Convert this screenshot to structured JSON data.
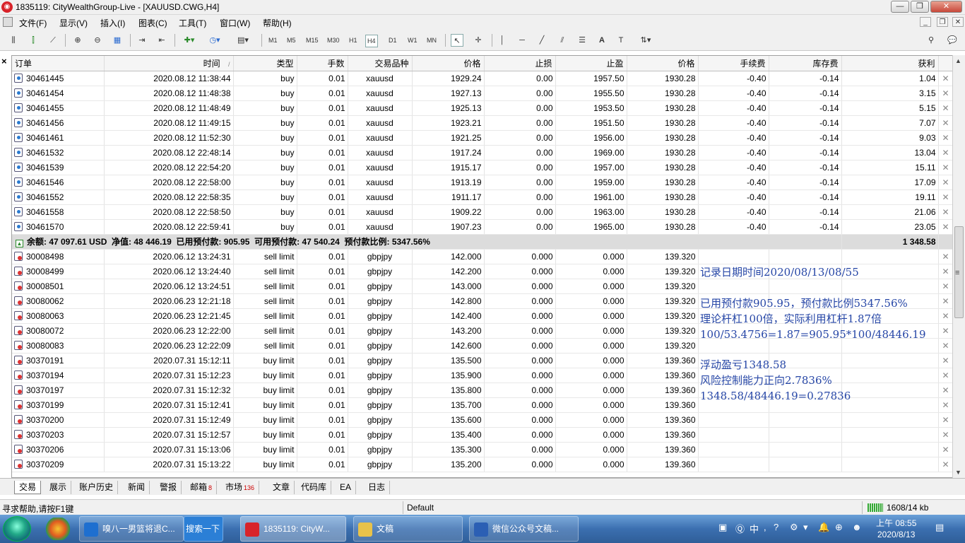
{
  "window": {
    "title": "1835119: CityWealthGroup-Live - [XAUUSD.CWG,H4]",
    "minimize": "—",
    "restore": "❐",
    "close": "✕"
  },
  "menu": {
    "items": [
      "文件(F)",
      "显示(V)",
      "插入(I)",
      "图表(C)",
      "工具(T)",
      "窗口(W)",
      "帮助(H)"
    ]
  },
  "toolbar": {
    "timeframes": [
      "M1",
      "M5",
      "M15",
      "M30",
      "H1",
      "H4",
      "D1",
      "W1",
      "MN"
    ],
    "active_timeframe": "H4"
  },
  "table": {
    "columns": [
      "订单",
      "时间",
      "类型",
      "手数",
      "交易品种",
      "价格",
      "止损",
      "止盈",
      "价格",
      "手续费",
      "库存费",
      "获利"
    ],
    "time_sort_marker": "/",
    "open_positions": [
      {
        "order": "30461445",
        "time": "2020.08.12 11:38:44",
        "type": "buy",
        "lots": "0.01",
        "symbol": "xauusd",
        "price": "1929.24",
        "sl": "0.00",
        "tp": "1957.50",
        "cur": "1930.28",
        "commission": "-0.40",
        "swap": "-0.14",
        "profit": "1.04"
      },
      {
        "order": "30461454",
        "time": "2020.08.12 11:48:38",
        "type": "buy",
        "lots": "0.01",
        "symbol": "xauusd",
        "price": "1927.13",
        "sl": "0.00",
        "tp": "1955.50",
        "cur": "1930.28",
        "commission": "-0.40",
        "swap": "-0.14",
        "profit": "3.15"
      },
      {
        "order": "30461455",
        "time": "2020.08.12 11:48:49",
        "type": "buy",
        "lots": "0.01",
        "symbol": "xauusd",
        "price": "1925.13",
        "sl": "0.00",
        "tp": "1953.50",
        "cur": "1930.28",
        "commission": "-0.40",
        "swap": "-0.14",
        "profit": "5.15"
      },
      {
        "order": "30461456",
        "time": "2020.08.12 11:49:15",
        "type": "buy",
        "lots": "0.01",
        "symbol": "xauusd",
        "price": "1923.21",
        "sl": "0.00",
        "tp": "1951.50",
        "cur": "1930.28",
        "commission": "-0.40",
        "swap": "-0.14",
        "profit": "7.07"
      },
      {
        "order": "30461461",
        "time": "2020.08.12 11:52:30",
        "type": "buy",
        "lots": "0.01",
        "symbol": "xauusd",
        "price": "1921.25",
        "sl": "0.00",
        "tp": "1956.00",
        "cur": "1930.28",
        "commission": "-0.40",
        "swap": "-0.14",
        "profit": "9.03"
      },
      {
        "order": "30461532",
        "time": "2020.08.12 22:48:14",
        "type": "buy",
        "lots": "0.01",
        "symbol": "xauusd",
        "price": "1917.24",
        "sl": "0.00",
        "tp": "1969.00",
        "cur": "1930.28",
        "commission": "-0.40",
        "swap": "-0.14",
        "profit": "13.04"
      },
      {
        "order": "30461539",
        "time": "2020.08.12 22:54:20",
        "type": "buy",
        "lots": "0.01",
        "symbol": "xauusd",
        "price": "1915.17",
        "sl": "0.00",
        "tp": "1957.00",
        "cur": "1930.28",
        "commission": "-0.40",
        "swap": "-0.14",
        "profit": "15.11"
      },
      {
        "order": "30461546",
        "time": "2020.08.12 22:58:00",
        "type": "buy",
        "lots": "0.01",
        "symbol": "xauusd",
        "price": "1913.19",
        "sl": "0.00",
        "tp": "1959.00",
        "cur": "1930.28",
        "commission": "-0.40",
        "swap": "-0.14",
        "profit": "17.09"
      },
      {
        "order": "30461552",
        "time": "2020.08.12 22:58:35",
        "type": "buy",
        "lots": "0.01",
        "symbol": "xauusd",
        "price": "1911.17",
        "sl": "0.00",
        "tp": "1961.00",
        "cur": "1930.28",
        "commission": "-0.40",
        "swap": "-0.14",
        "profit": "19.11"
      },
      {
        "order": "30461558",
        "time": "2020.08.12 22:58:50",
        "type": "buy",
        "lots": "0.01",
        "symbol": "xauusd",
        "price": "1909.22",
        "sl": "0.00",
        "tp": "1963.00",
        "cur": "1930.28",
        "commission": "-0.40",
        "swap": "-0.14",
        "profit": "21.06"
      },
      {
        "order": "30461570",
        "time": "2020.08.12 22:59:41",
        "type": "buy",
        "lots": "0.01",
        "symbol": "xauusd",
        "price": "1907.23",
        "sl": "0.00",
        "tp": "1965.00",
        "cur": "1930.28",
        "commission": "-0.40",
        "swap": "-0.14",
        "profit": "23.05"
      }
    ],
    "summary": {
      "text": "余额: 47 097.61 USD  净值: 48 446.19  已用预付款: 905.95  可用预付款: 47 540.24  预付款比例: 5347.56%",
      "total": "1 348.58"
    },
    "pending_orders": [
      {
        "order": "30008498",
        "time": "2020.06.12 13:24:31",
        "type": "sell limit",
        "lots": "0.01",
        "symbol": "gbpjpy",
        "price": "142.000",
        "sl": "0.000",
        "tp": "0.000",
        "cur": "139.320"
      },
      {
        "order": "30008499",
        "time": "2020.06.12 13:24:40",
        "type": "sell limit",
        "lots": "0.01",
        "symbol": "gbpjpy",
        "price": "142.200",
        "sl": "0.000",
        "tp": "0.000",
        "cur": "139.320"
      },
      {
        "order": "30008501",
        "time": "2020.06.12 13:24:51",
        "type": "sell limit",
        "lots": "0.01",
        "symbol": "gbpjpy",
        "price": "143.000",
        "sl": "0.000",
        "tp": "0.000",
        "cur": "139.320"
      },
      {
        "order": "30080062",
        "time": "2020.06.23 12:21:18",
        "type": "sell limit",
        "lots": "0.01",
        "symbol": "gbpjpy",
        "price": "142.800",
        "sl": "0.000",
        "tp": "0.000",
        "cur": "139.320"
      },
      {
        "order": "30080063",
        "time": "2020.06.23 12:21:45",
        "type": "sell limit",
        "lots": "0.01",
        "symbol": "gbpjpy",
        "price": "142.400",
        "sl": "0.000",
        "tp": "0.000",
        "cur": "139.320"
      },
      {
        "order": "30080072",
        "time": "2020.06.23 12:22:00",
        "type": "sell limit",
        "lots": "0.01",
        "symbol": "gbpjpy",
        "price": "143.200",
        "sl": "0.000",
        "tp": "0.000",
        "cur": "139.320"
      },
      {
        "order": "30080083",
        "time": "2020.06.23 12:22:09",
        "type": "sell limit",
        "lots": "0.01",
        "symbol": "gbpjpy",
        "price": "142.600",
        "sl": "0.000",
        "tp": "0.000",
        "cur": "139.320"
      },
      {
        "order": "30370191",
        "time": "2020.07.31 15:12:11",
        "type": "buy limit",
        "lots": "0.01",
        "symbol": "gbpjpy",
        "price": "135.500",
        "sl": "0.000",
        "tp": "0.000",
        "cur": "139.360"
      },
      {
        "order": "30370194",
        "time": "2020.07.31 15:12:23",
        "type": "buy limit",
        "lots": "0.01",
        "symbol": "gbpjpy",
        "price": "135.900",
        "sl": "0.000",
        "tp": "0.000",
        "cur": "139.360"
      },
      {
        "order": "30370197",
        "time": "2020.07.31 15:12:32",
        "type": "buy limit",
        "lots": "0.01",
        "symbol": "gbpjpy",
        "price": "135.800",
        "sl": "0.000",
        "tp": "0.000",
        "cur": "139.360"
      },
      {
        "order": "30370199",
        "time": "2020.07.31 15:12:41",
        "type": "buy limit",
        "lots": "0.01",
        "symbol": "gbpjpy",
        "price": "135.700",
        "sl": "0.000",
        "tp": "0.000",
        "cur": "139.360"
      },
      {
        "order": "30370200",
        "time": "2020.07.31 15:12:49",
        "type": "buy limit",
        "lots": "0.01",
        "symbol": "gbpjpy",
        "price": "135.600",
        "sl": "0.000",
        "tp": "0.000",
        "cur": "139.360"
      },
      {
        "order": "30370203",
        "time": "2020.07.31 15:12:57",
        "type": "buy limit",
        "lots": "0.01",
        "symbol": "gbpjpy",
        "price": "135.400",
        "sl": "0.000",
        "tp": "0.000",
        "cur": "139.360"
      },
      {
        "order": "30370206",
        "time": "2020.07.31 15:13:06",
        "type": "buy limit",
        "lots": "0.01",
        "symbol": "gbpjpy",
        "price": "135.300",
        "sl": "0.000",
        "tp": "0.000",
        "cur": "139.360"
      },
      {
        "order": "30370209",
        "time": "2020.07.31 15:13:22",
        "type": "buy limit",
        "lots": "0.01",
        "symbol": "gbpjpy",
        "price": "135.200",
        "sl": "0.000",
        "tp": "0.000",
        "cur": "139.360"
      }
    ],
    "close_glyph": "✕"
  },
  "notes": {
    "lines": [
      "记录日期时间2020/08/13/08/55",
      "已用预付款905.95，预付款比例5347.56%",
      "理论杆杠100倍，实际利用杠杆1.87倍",
      "100/53.4756=1.87=905.95*100/48446.19",
      "浮动盈亏1348.58",
      "风险控制能力正向2.7836%",
      "1348.58/48446.19=0.27836"
    ]
  },
  "bottom_tabs": [
    {
      "label": "交易",
      "active": true
    },
    {
      "label": "展示"
    },
    {
      "label": "账户历史"
    },
    {
      "label": "新闻"
    },
    {
      "label": "警报"
    },
    {
      "label": "邮箱",
      "badge": "8"
    },
    {
      "label": "市场",
      "badge": "136"
    },
    {
      "label": "文章"
    },
    {
      "label": "代码库"
    },
    {
      "label": "EA"
    },
    {
      "label": "日志"
    }
  ],
  "statusbar": {
    "help": "寻求帮助,请按F1键",
    "profile": "Default",
    "traffic": "1608/14 kb"
  },
  "taskbar": {
    "buttons": [
      {
        "label": "嗅八一男篮将退C...",
        "icon_color": "#1e6fd0"
      },
      {
        "label": "1835119: CityW...",
        "icon_color": "#d8232a",
        "active": true
      },
      {
        "label": "文稿",
        "icon_color": "#e8c24a"
      },
      {
        "label": "微信公众号文稿...",
        "icon_color": "#2b5fb4"
      }
    ],
    "search_label": "搜索一下",
    "ime": "中",
    "clock_time": "上午 08:55",
    "clock_date": "2020/8/13"
  }
}
